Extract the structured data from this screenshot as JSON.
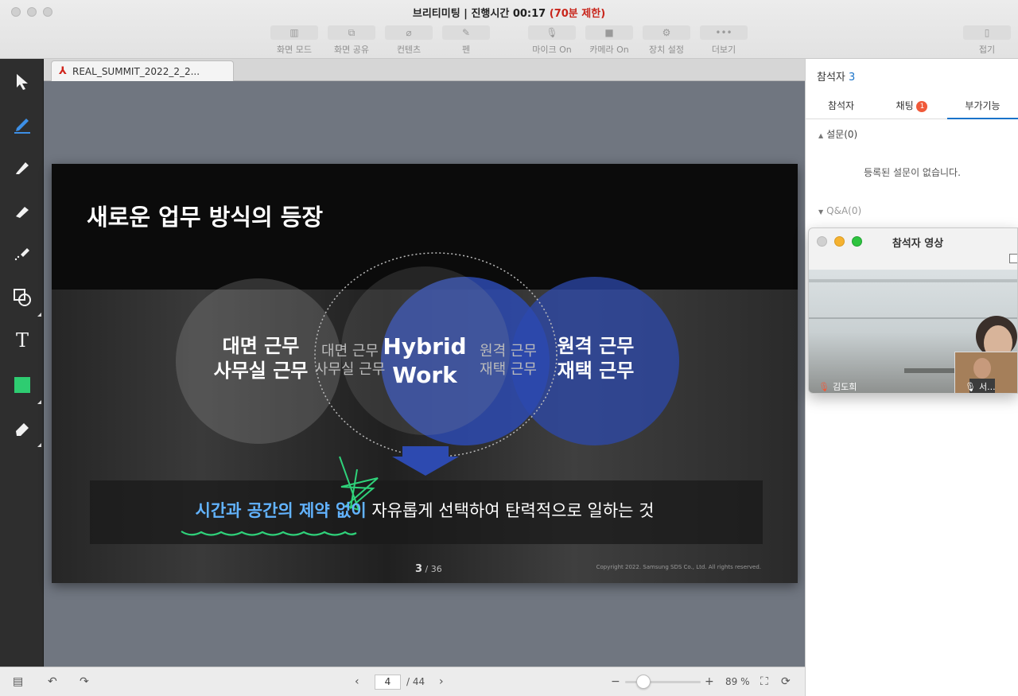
{
  "window": {
    "title_prefix": "브리티미팅  |  진행시간 00:17",
    "title_limit": "(70분 제한)"
  },
  "toolbar": [
    {
      "label": "화면 모드",
      "icon": "screen-mode-icon"
    },
    {
      "label": "화면 공유",
      "icon": "screen-share-icon"
    },
    {
      "label": "컨텐츠",
      "icon": "paperclip-icon"
    },
    {
      "label": "펜",
      "icon": "pen-icon"
    },
    {
      "label": "마이크 On",
      "icon": "microphone-icon"
    },
    {
      "label": "카메라 On",
      "icon": "camera-icon"
    },
    {
      "label": "장치 설정",
      "icon": "gear-icon"
    },
    {
      "label": "더보기",
      "icon": "more-icon"
    }
  ],
  "collapse_label": "접기",
  "document": {
    "tab_title": "REAL_SUMMIT_2022_2_2...",
    "page_current": "4",
    "page_total": "/ 44",
    "zoom": "89 %",
    "zoom_level_fraction": 0.15
  },
  "slide": {
    "title": "새로운 업무 방식의 등장",
    "left_main": "대면 근무\n사무실 근무",
    "left_sub": "대면 근무\n사무실 근무",
    "center": "Hybrid\nWork",
    "right_sub": "원격 근무\n재택 근무",
    "right_main": "원격 근무\n재택 근무",
    "band_highlight": "시간과 공간의 제약 없이",
    "band_rest": " 자유롭게 선택하여 탄력적으로 일하는 것",
    "page_num": "3",
    "page_total": "/ 36",
    "copyright": "Copyright 2022. Samsung SDS Co., Ltd. All rights reserved."
  },
  "panel": {
    "header_label": "참석자",
    "header_count": "3",
    "tabs": [
      "참석자",
      "채팅",
      "부가기능"
    ],
    "chat_badge": "1",
    "survey_label": "설문(0)",
    "survey_empty": "등록된 설문이 없습니다.",
    "qa_label": "Q&A(0)"
  },
  "video_window": {
    "title": "참석자 영상",
    "participant_main": "김도희",
    "participant_pip": "서..."
  },
  "colors": {
    "accent": "#1a73c9",
    "limit_red": "#c8251b",
    "highlight_blue": "#62b3ff",
    "tool_green": "#2ecc71",
    "venn_blue": "#2d4ab0"
  }
}
